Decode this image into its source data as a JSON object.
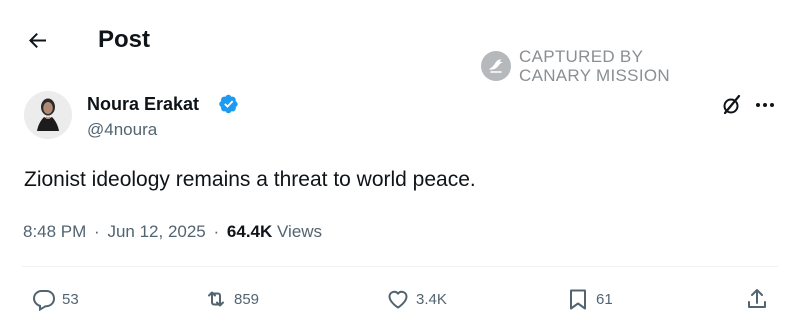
{
  "header": {
    "title": "Post",
    "back_icon": "arrow-left-icon"
  },
  "watermark": {
    "line1": "CAPTURED BY",
    "line2": "CANARY MISSION",
    "logo_icon": "canary-bird-icon"
  },
  "author": {
    "name": "Noura Erakat",
    "handle": "@4noura",
    "verified": true,
    "verified_color": "#1d9bf0"
  },
  "post": {
    "text": "Zionist ideology remains a threat to world peace."
  },
  "meta": {
    "time": "8:48 PM",
    "separator": "·",
    "date": "Jun 12, 2025",
    "views_count": "64.4K",
    "views_label": "Views"
  },
  "actions": {
    "reply": {
      "icon": "reply-icon",
      "count": "53"
    },
    "repost": {
      "icon": "repost-icon",
      "count": "859"
    },
    "like": {
      "icon": "heart-icon",
      "count": "3.4K"
    },
    "bookmark": {
      "icon": "bookmark-icon",
      "count": "61"
    },
    "share": {
      "icon": "share-icon"
    }
  },
  "top_actions": {
    "grok_icon": "grok-icon",
    "more_icon": "more-dots-icon"
  },
  "colors": {
    "text": "#0f1419",
    "secondary": "#536471",
    "accent": "#1d9bf0",
    "watermark": "#8a8f93"
  }
}
